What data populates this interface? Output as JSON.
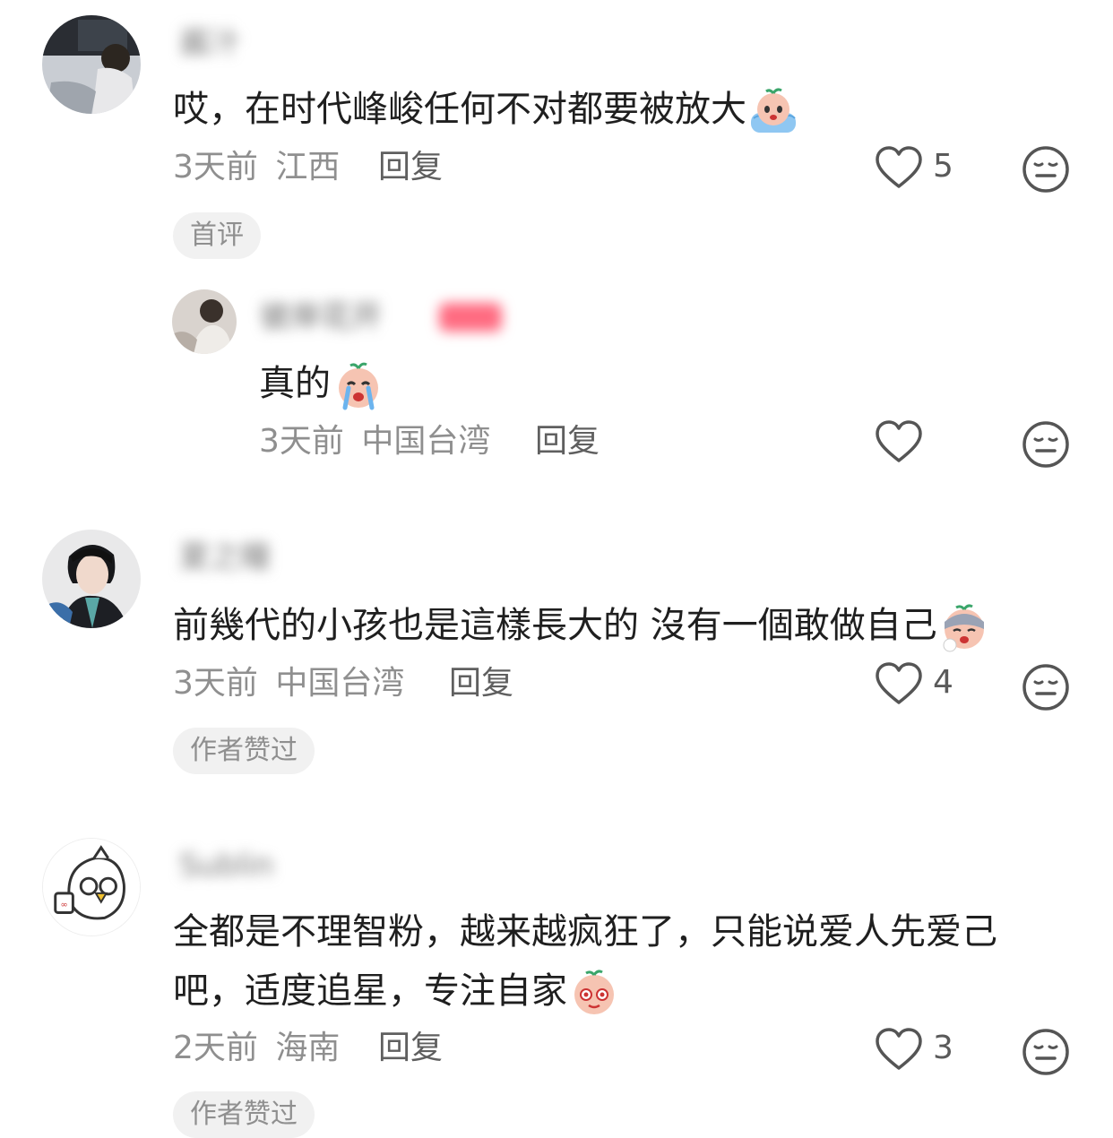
{
  "comments": [
    {
      "username": "酱汁",
      "text": "哎，在时代峰峻任何不对都要被放大",
      "time": "3天前",
      "location": "江西",
      "reply_label": "回复",
      "likes": "5",
      "badge": "首评",
      "emoji_icon": "crying-peach-emoji",
      "reply": {
        "username": "彼岸花开",
        "text": "真的",
        "time": "3天前",
        "location": "中国台湾",
        "reply_label": "回复",
        "emoji_icon": "sobbing-peach-emoji"
      }
    },
    {
      "username": "夏之瞳",
      "text": "前幾代的小孩也是這樣長大的 沒有一個敢做自己",
      "time": "3天前",
      "location": "中国台湾",
      "reply_label": "回复",
      "likes": "4",
      "badge": "作者赞过",
      "emoji_icon": "sick-peach-emoji"
    },
    {
      "username": "Sublin",
      "text_line1": "全都是不理智粉，越来越疯狂了，只能说爱人先爱己",
      "text_line2": "吧，适度追星，专注自家",
      "time": "2天前",
      "location": "海南",
      "reply_label": "回复",
      "likes": "3",
      "badge": "作者赞过",
      "emoji_icon": "dizzy-peach-emoji"
    }
  ],
  "colors": {
    "text": "#1f1f1f",
    "meta": "#8f8f8f",
    "badge_bg": "#f1f1f1",
    "icon": "#555555"
  }
}
